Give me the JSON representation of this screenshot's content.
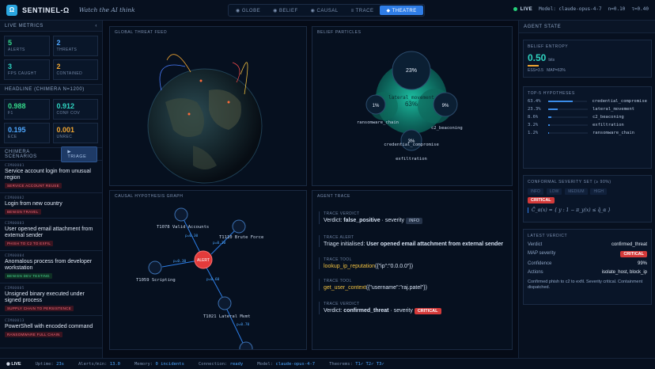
{
  "header": {
    "brand": "SENTINEL-Ω",
    "logo_glyph": "Ω",
    "tagline": "Watch the AI think",
    "tabs": [
      {
        "label": "◉ GLOBE",
        "active": false
      },
      {
        "label": "◉ BELIEF",
        "active": false
      },
      {
        "label": "◉ CAUSAL",
        "active": false
      },
      {
        "label": "≡ TRACE",
        "active": false
      },
      {
        "label": "◆ THEATRE",
        "active": true
      }
    ],
    "status": {
      "live": "LIVE",
      "model": "Model: claude-opus-4-7",
      "n": "n=0.10",
      "t": "τ=0.40"
    }
  },
  "left": {
    "live_metrics_title": "LIVE METRICS",
    "collapse_glyph": "‹",
    "metrics": [
      {
        "value": "5",
        "label": "ALERTS",
        "color": "green"
      },
      {
        "value": "2",
        "label": "THREATS",
        "color": "blue"
      },
      {
        "value": "3",
        "label": "FPS CAUGHT",
        "color": "teal"
      },
      {
        "value": "2",
        "label": "CONTAINED",
        "color": "amber"
      }
    ],
    "headline_title": "HEADLINE (CHIMERA N=1200)",
    "headline": [
      {
        "value": "0.988",
        "label": "F1",
        "color": "green"
      },
      {
        "value": "0.912",
        "label": "CONF COV",
        "color": "teal"
      },
      {
        "value": "0.195",
        "label": "ECE",
        "color": "blue"
      },
      {
        "value": "0.001",
        "label": "UNREC",
        "color": "amber"
      }
    ],
    "scenarios_title": "CHIMERA SCENARIOS",
    "triage_label": "▶ TRIAGE",
    "scenarios": [
      {
        "id": "CIM00001",
        "title": "Service account login from unusual region",
        "tag": "SERVICE ACCOUNT REUSE",
        "tag_color": "red"
      },
      {
        "id": "CIM00002",
        "title": "Login from new country",
        "tag": "BENIGN TRAVEL",
        "tag_color": "red"
      },
      {
        "id": "CIM00003",
        "title": "User opened email attachment from external sender",
        "tag": "PHISH TO C2 TO EXFIL",
        "tag_color": "red"
      },
      {
        "id": "CIM00004",
        "title": "Anomalous process from developer workstation",
        "tag": "BENIGN DEV TESTING",
        "tag_color": "green"
      },
      {
        "id": "CIM00005",
        "title": "Unsigned binary executed under signed process",
        "tag": "SUPPLY CHAIN TO PERSISTENCE",
        "tag_color": "red"
      },
      {
        "id": "CIM00013",
        "title": "PowerShell with encoded command",
        "tag": "RANSOMWARE FULL CHAIN",
        "tag_color": "red"
      }
    ]
  },
  "globe": {
    "title": "GLOBAL THREAT FEED"
  },
  "belief": {
    "title": "BELIEF PARTICLES",
    "bubbles": [
      {
        "pct": "23%",
        "name": ""
      },
      {
        "pct": "63%",
        "name": "lateral_movement"
      },
      {
        "pct": "1%",
        "name": "ransomware_chain"
      },
      {
        "pct": "9%",
        "name": "c2_beaconing"
      },
      {
        "pct": "3%",
        "name": "credential_compromise"
      },
      {
        "pct": "",
        "name": "exfiltration"
      }
    ]
  },
  "causal": {
    "title": "CAUSAL HYPOTHESIS GRAPH",
    "nodes": [
      "T1078 Valid Accounts",
      "T1110 Brute Force",
      "ALERT",
      "T1059 Scripting",
      "T1021 Lateral Mvmt"
    ],
    "edges": [
      "p=0.30",
      "p=0.30",
      "p=0.30",
      "p=0.60",
      "p=0.70"
    ]
  },
  "trace": {
    "title": "AGENT TRACE",
    "items": [
      {
        "kind": "TRACE VERDICT",
        "prefix": "Verdict: ",
        "strong": "false_positive",
        "suffix": " · severity",
        "pill": "INFO",
        "pill_kind": "info"
      },
      {
        "kind": "TRACE ALERT",
        "prefix": "Triage initialised: ",
        "strong": "User opened email attachment from external sender"
      },
      {
        "kind": "TRACE TOOL",
        "fn": "lookup_ip_reputation",
        "args": "({\"ip\":\"0.0.0.0\"})"
      },
      {
        "kind": "TRACE TOOL",
        "fn": "get_user_context",
        "args": "({\"username\":\"raj.patel\"})"
      },
      {
        "kind": "TRACE VERDICT",
        "prefix": "Verdict: ",
        "strong": "confirmed_threat",
        "suffix": " · severity",
        "pill": "CRITICAL",
        "pill_kind": "crit"
      }
    ]
  },
  "right": {
    "title": "AGENT STATE",
    "entropy": {
      "title": "BELIEF ENTROPY",
      "value": "0.50",
      "unit": "bits",
      "ess": "ESS=3.5",
      "map": "MAP=63%"
    },
    "hypotheses": {
      "title": "TOP-5 HYPOTHESES",
      "items": [
        {
          "p": "63.4%",
          "name": "credential_compromise",
          "frac": 0.634
        },
        {
          "p": "23.3%",
          "name": "lateral_movement",
          "frac": 0.233
        },
        {
          "p": "8.6%",
          "name": "c2_beaconing",
          "frac": 0.086
        },
        {
          "p": "3.2%",
          "name": "exfiltration",
          "frac": 0.032
        },
        {
          "p": "1.2%",
          "name": "ransomware_chain",
          "frac": 0.012
        }
      ]
    },
    "conformal": {
      "title": "CONFORMAL SEVERITY SET (≥ 90%)",
      "chips": [
        "INFO",
        "LOW",
        "MEDIUM",
        "HIGH"
      ],
      "selected": "CRITICAL",
      "formula": "Ĉ_α(x) = { y : 1 − π_y(x) ≤ q̂_α }"
    },
    "verdict": {
      "title": "LATEST VERDICT",
      "rows": [
        {
          "k": "Verdict",
          "v": "confirmed_threat"
        },
        {
          "k": "MAP severity",
          "v": "CRITICAL"
        },
        {
          "k": "Confidence",
          "v": "99%"
        },
        {
          "k": "Actions",
          "v": "isolate_host, block_ip"
        }
      ],
      "summary": "Confirmed phish to c2 to exfil. Severity critical. Containment dispatched."
    }
  },
  "footer": {
    "live": "◉ LIVE",
    "uptime": "Uptime:",
    "uptime_v": "23s",
    "alerts": "Alerts/min:",
    "alerts_v": "13.0",
    "memory": "Memory:",
    "memory_v": "0 incidents",
    "conn": "Connection:",
    "conn_v": "ready",
    "model": "Model:",
    "model_v": "claude-opus-4-7",
    "theorems": "Theorems:",
    "theorems_v": "T1✓ T2✓ T3✓"
  }
}
